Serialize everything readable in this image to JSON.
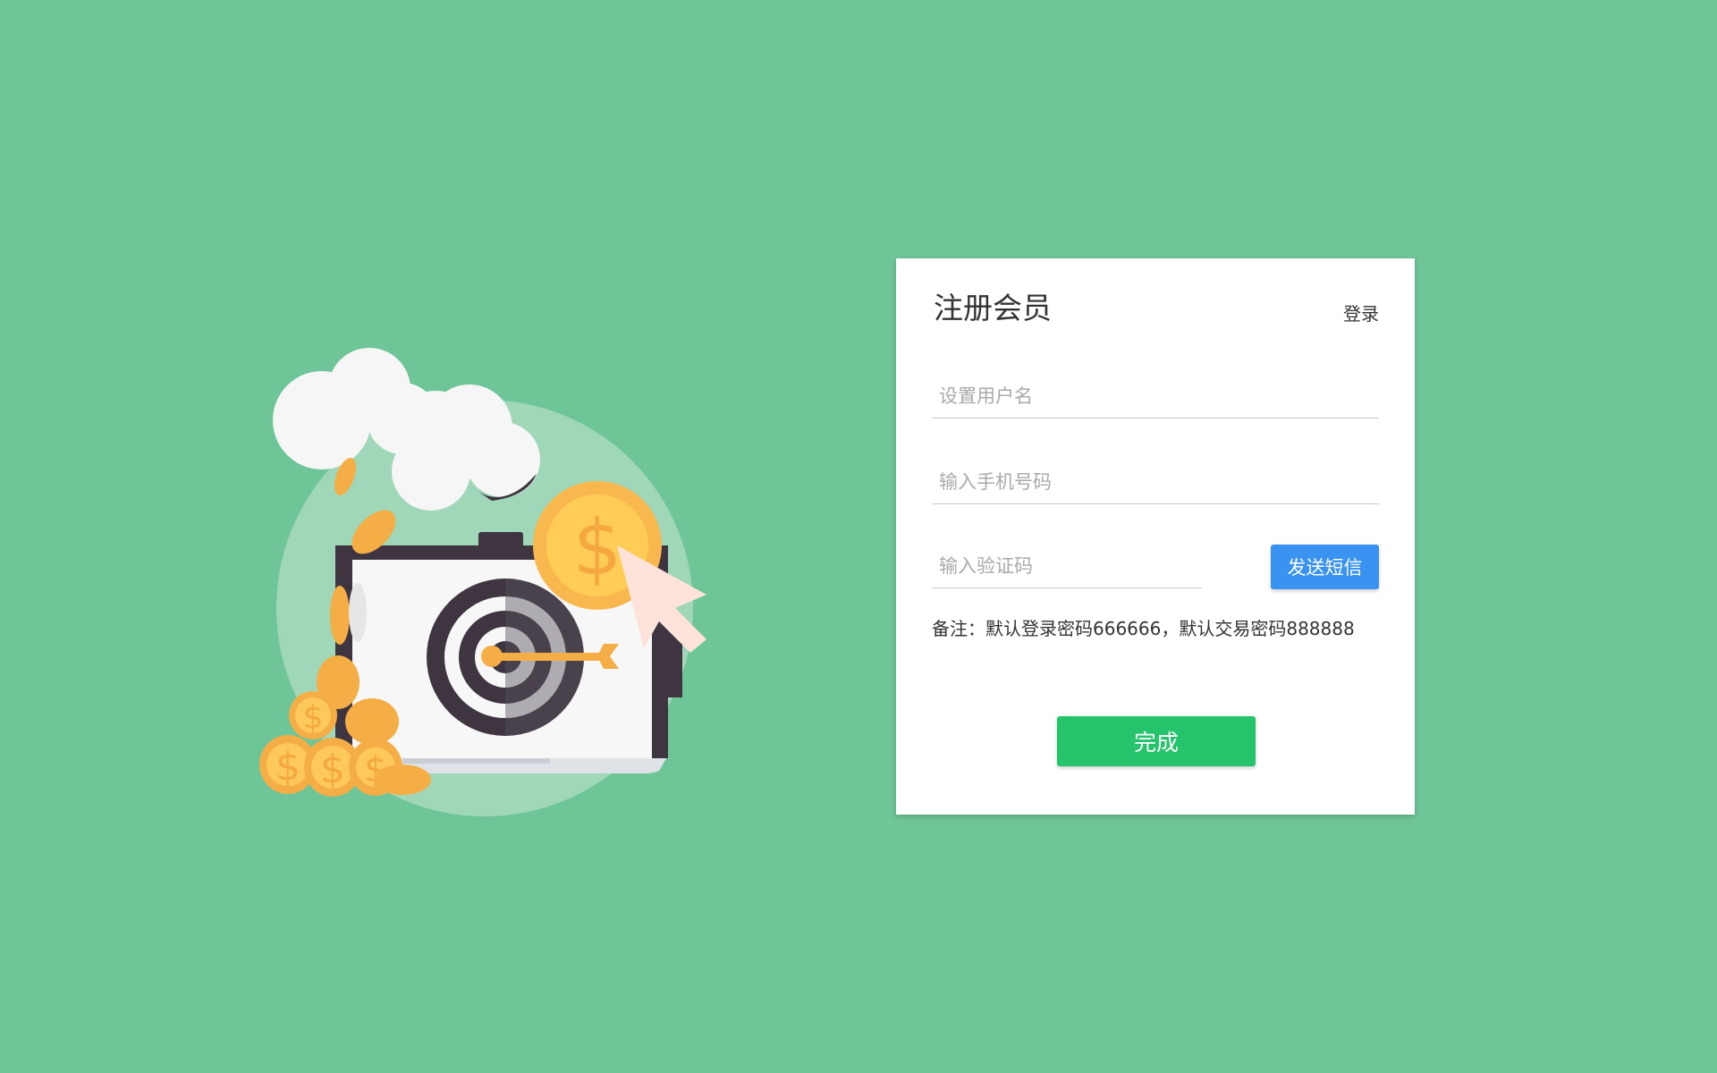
{
  "colors": {
    "background": "#6ec597",
    "card": "#ffffff",
    "sms_button": "#3a93f0",
    "submit_button": "#24c36c",
    "coin": "#f7b84a",
    "target_dark": "#3e3540"
  },
  "illustration": {
    "icon": "laptop-target-coins-illustration"
  },
  "form": {
    "title": "注册会员",
    "login_link": "登录",
    "username_placeholder": "设置用户名",
    "phone_placeholder": "输入手机号码",
    "code_placeholder": "输入验证码",
    "sms_button": "发送短信",
    "note": "备注：默认登录密码666666，默认交易密码888888",
    "submit_button": "完成"
  }
}
